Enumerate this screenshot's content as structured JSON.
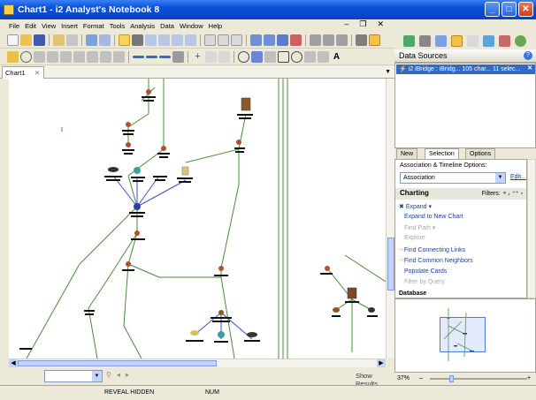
{
  "window": {
    "title": "Chart1 - i2 Analyst's Notebook 8"
  },
  "menu": {
    "items": [
      "File",
      "Edit",
      "View",
      "Insert",
      "Format",
      "Tools",
      "Analysis",
      "Data",
      "Window",
      "Help"
    ]
  },
  "tabs": {
    "chart_tab": "Chart1"
  },
  "data_sources": {
    "header": "Data Sources",
    "item": "i2 iBridge : iBridg...  105 char...  11 selec..."
  },
  "panel_tabs": [
    "New",
    "Selection",
    "Options"
  ],
  "options": {
    "assoc_label": "Association & Timeline Options:",
    "assoc_value": "Association",
    "edit_link": "Edit...",
    "charting_label": "Charting",
    "filters_label": "Filters:",
    "items": [
      {
        "label": "Expand",
        "enabled": true
      },
      {
        "label": "Expand to New Chart",
        "enabled": true
      },
      {
        "label": "Find Path",
        "enabled": false
      },
      {
        "label": "Explore",
        "enabled": false
      },
      {
        "label": "Find Connecting Links",
        "enabled": true
      },
      {
        "label": "Find Common Neighbors",
        "enabled": true
      },
      {
        "label": "Populate Cards",
        "enabled": true
      },
      {
        "label": "Filter by Query",
        "enabled": false
      }
    ],
    "database_label": "Database"
  },
  "find": {
    "show_results": "Show Results"
  },
  "zoom": {
    "percent": "37%"
  },
  "status": {
    "reveal_hidden": "REVEAL HIDDEN",
    "num": "NUM"
  },
  "colors": {
    "link_green": "#4a8a3a",
    "link_blue": "#3c4fc0",
    "selection_blue": "#316ac5"
  }
}
